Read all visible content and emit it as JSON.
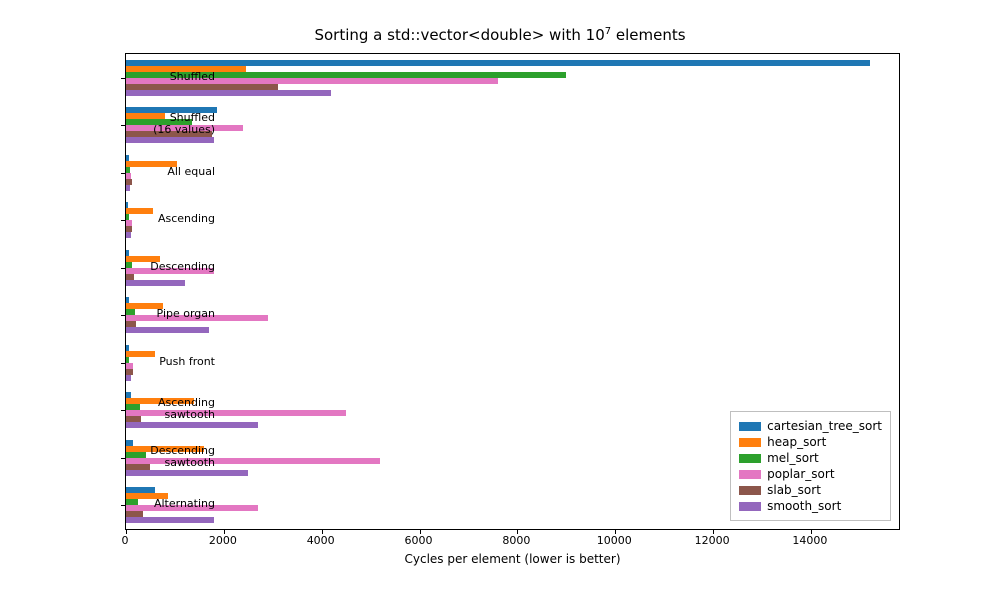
{
  "title_html": "Sorting a std::vector&lt;double&gt; with 10<sup>7</sup> elements",
  "xlabel": "Cycles per element (lower is better)",
  "legend": [
    "cartesian_tree_sort",
    "heap_sort",
    "mel_sort",
    "poplar_sort",
    "slab_sort",
    "smooth_sort"
  ],
  "chart_data": {
    "type": "bar",
    "orientation": "horizontal",
    "xlabel": "Cycles per element (lower is better)",
    "ylabel": "",
    "xlim": [
      0,
      15800
    ],
    "categories": [
      "Shuffled",
      "Shuffled\n(16 values)",
      "All equal",
      "Ascending",
      "Descending",
      "Pipe organ",
      "Push front",
      "Ascending\nsawtooth",
      "Descending\nsawtooth",
      "Alternating"
    ],
    "series": [
      {
        "name": "cartesian_tree_sort",
        "values": [
          15200,
          1850,
          60,
          50,
          60,
          65,
          60,
          100,
          150,
          600
        ]
      },
      {
        "name": "heap_sort",
        "values": [
          2450,
          800,
          1050,
          550,
          700,
          750,
          600,
          1400,
          1600,
          850
        ]
      },
      {
        "name": "mel_sort",
        "values": [
          9000,
          1350,
          80,
          70,
          120,
          180,
          70,
          280,
          400,
          250
        ]
      },
      {
        "name": "poplar_sort",
        "values": [
          7600,
          2400,
          100,
          120,
          1800,
          2900,
          140,
          4500,
          5200,
          2700
        ]
      },
      {
        "name": "slab_sort",
        "values": [
          3100,
          1750,
          120,
          130,
          160,
          200,
          150,
          300,
          500,
          350
        ]
      },
      {
        "name": "smooth_sort",
        "values": [
          4200,
          1800,
          90,
          100,
          1200,
          1700,
          100,
          2700,
          2500,
          1800
        ]
      }
    ],
    "xticks": [
      0,
      2000,
      4000,
      6000,
      8000,
      10000,
      12000,
      14000
    ],
    "title": "Sorting a std::vector<double> with 10^7 elements"
  }
}
